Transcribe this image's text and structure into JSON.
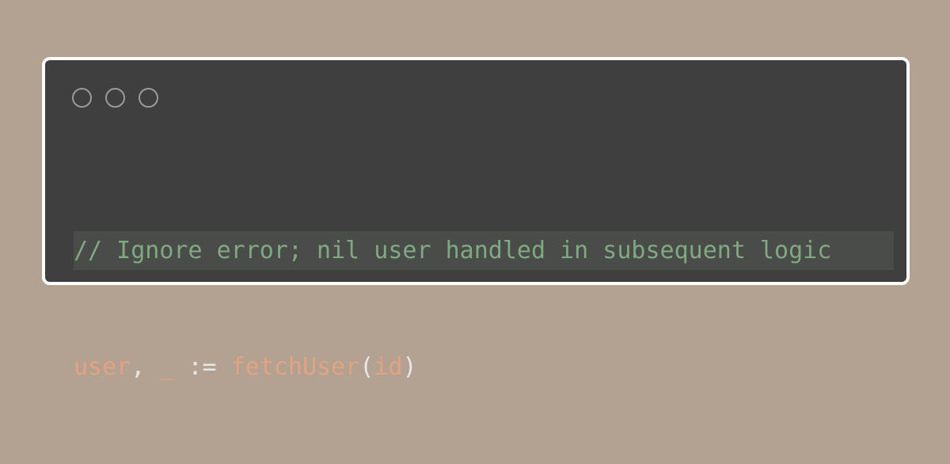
{
  "window_controls": [
    "close",
    "minimize",
    "zoom"
  ],
  "code": {
    "comment": "// Ignore error; nil user handled in subsequent logic",
    "var_name": "user",
    "comma": ",",
    "blank": "_",
    "assign": ":=",
    "func_name": "fetchUser",
    "paren_open": "(",
    "arg": "id",
    "paren_close": ")"
  },
  "colors": {
    "background": "#b3a291",
    "editor": "#3f3f3f",
    "comment": "#80a881",
    "identifier": "#e2a283",
    "operator": "#e8e8e8",
    "highlight": "#4a4c4a"
  }
}
